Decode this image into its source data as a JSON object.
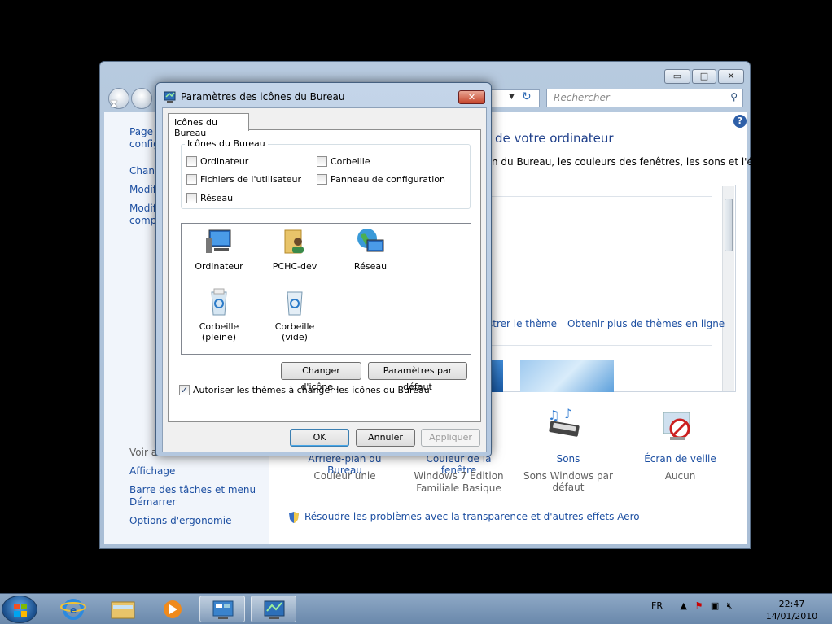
{
  "bg_window": {
    "minimize_label": "▭",
    "maximize_label": "□",
    "close_label": "✕",
    "search_placeholder": "Rechercher",
    "left_links": [
      "Page ...",
      "config...",
      "Chang...",
      "Modif...",
      "Modif...",
      "compt..."
    ],
    "voir_aussi": "Voir au...",
    "see_also_links": [
      "Affichage",
      "Barre des tâches et menu",
      "Démarrer",
      "Options d'ergonomie"
    ],
    "heading": "de votre ordinateur",
    "subtitle": "n du Bureau, les couleurs des fenêtres, les sons et l'écran",
    "theme_link_1": "strer le thème",
    "theme_link_2": "Obtenir plus de thèmes en ligne",
    "bottom_items": [
      {
        "title": "Arrière-plan du Bureau",
        "value": "Couleur unie"
      },
      {
        "title": "Couleur de la fenêtre",
        "value": "Windows 7 Édition",
        "value2": "Familiale Basique"
      },
      {
        "title": "Sons",
        "value": "Sons Windows par défaut"
      },
      {
        "title": "Écran de veille",
        "value": "Aucun"
      }
    ],
    "troubleshoot": "Résoudre les problèmes avec la transparence et d'autres effets Aero"
  },
  "dialog": {
    "title": "Paramètres des icônes du Bureau",
    "tab": "Icônes du Bureau",
    "group_title": "Icônes du Bureau",
    "checkboxes": [
      {
        "label": "Ordinateur",
        "checked": false
      },
      {
        "label": "Corbeille",
        "checked": false
      },
      {
        "label": "Fichiers de l'utilisateur",
        "checked": false
      },
      {
        "label": "Panneau de configuration",
        "checked": false
      },
      {
        "label": "Réseau",
        "checked": false
      }
    ],
    "icons": [
      "Ordinateur",
      "PCHC-dev",
      "Réseau",
      "Corbeille (pleine)",
      "Corbeille (vide)"
    ],
    "change_icon": "Changer d'icône...",
    "restore_default": "Paramètres par défaut",
    "allow_themes": "Autoriser les thèmes à changer les icônes du Bureau",
    "allow_themes_checked": true,
    "ok": "OK",
    "cancel": "Annuler",
    "apply": "Appliquer"
  },
  "taskbar": {
    "language": "FR",
    "time": "22:47",
    "date": "14/01/2010"
  }
}
